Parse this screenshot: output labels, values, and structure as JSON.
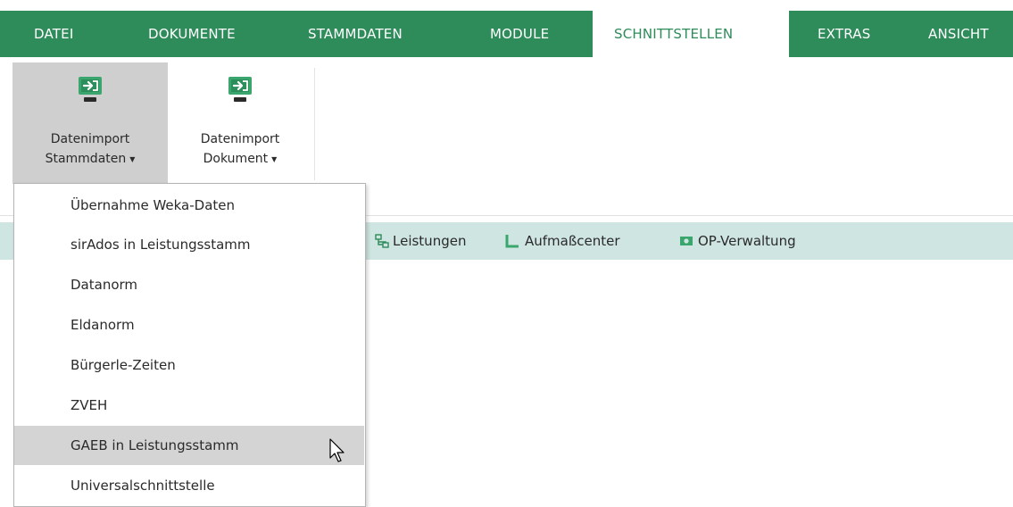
{
  "menu": {
    "tabs": [
      {
        "label": "DATEI"
      },
      {
        "label": "DOKUMENTE"
      },
      {
        "label": "STAMMDATEN"
      },
      {
        "label": "MODULE"
      },
      {
        "label": "SCHNITTSTELLEN",
        "active": true
      },
      {
        "label": "EXTRAS"
      },
      {
        "label": "ANSICHT"
      }
    ]
  },
  "ribbon": {
    "buttons": [
      {
        "line1": "Datenimport",
        "line2": "Stammdaten",
        "icon": "import-monitor-icon",
        "pressed": true
      },
      {
        "line1": "Datenimport",
        "line2": "Dokument",
        "icon": "import-monitor-icon",
        "pressed": false
      }
    ]
  },
  "quickbar": {
    "items": [
      {
        "label": "Leistungen",
        "icon": "services-icon"
      },
      {
        "label": "Aufmaßcenter",
        "icon": "measure-icon"
      },
      {
        "label": "OP-Verwaltung",
        "icon": "money-icon"
      }
    ]
  },
  "dropdown": {
    "items": [
      {
        "label": "Übernahme Weka-Daten"
      },
      {
        "label": "sirAdos in Leistungsstamm"
      },
      {
        "label": "Datanorm"
      },
      {
        "label": "Eldanorm"
      },
      {
        "label": "Bürgerle-Zeiten"
      },
      {
        "label": "ZVEH"
      },
      {
        "label": "GAEB in Leistungsstamm",
        "hover": true
      },
      {
        "label": "Universalschnittstelle"
      }
    ]
  },
  "colors": {
    "accent": "#2e8b5a",
    "quickbar_bg": "#cfe5e1",
    "pressed_bg": "#cfcfcf",
    "hover_bg": "#d4d4d4"
  }
}
